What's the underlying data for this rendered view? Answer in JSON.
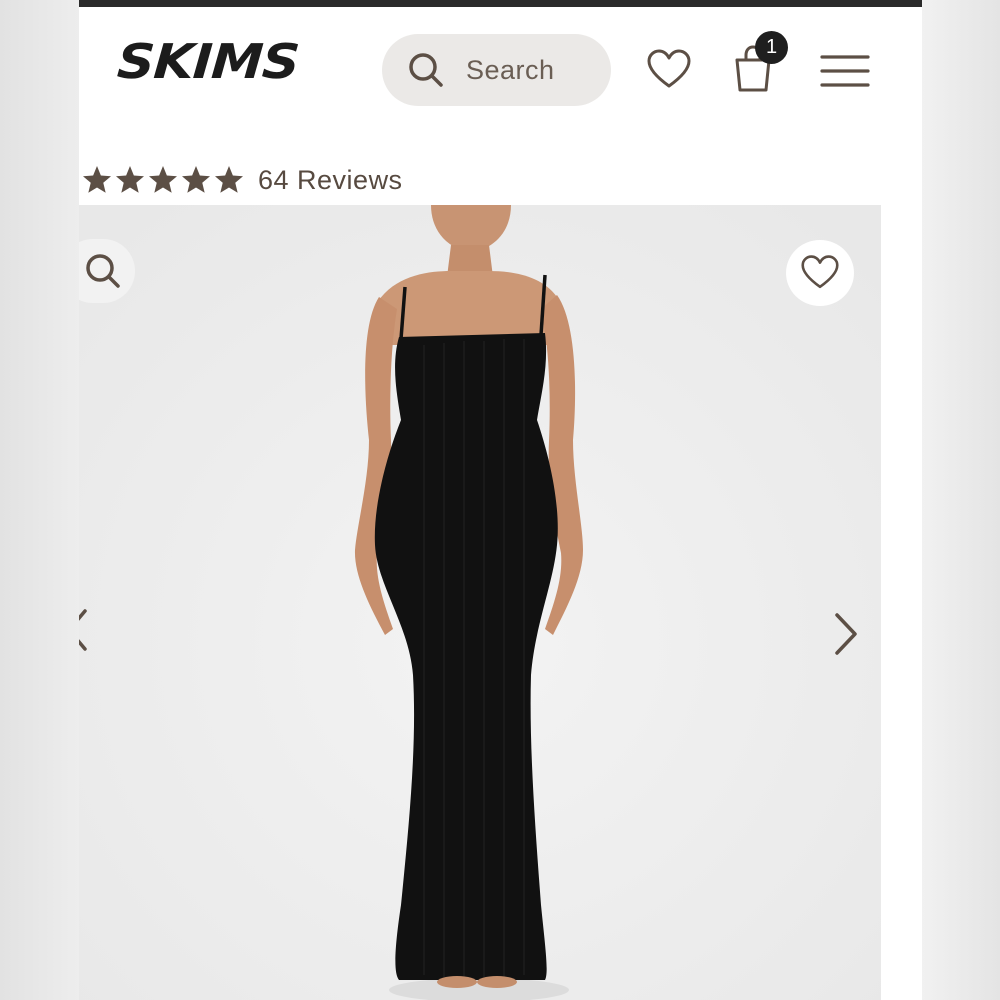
{
  "header": {
    "brand": "SKIMS",
    "search_placeholder": "Search",
    "cart_count": "1",
    "icons": [
      "search-icon",
      "heart-icon",
      "shopping-bag-icon",
      "hamburger-menu-icon"
    ]
  },
  "rating": {
    "stars": 5,
    "reviews_label": "64 Reviews"
  },
  "gallery": {
    "icons": [
      "zoom-icon",
      "heart-icon",
      "chevron-left-icon",
      "chevron-right-icon"
    ]
  },
  "colors": {
    "brand_text": "#1c1c1c",
    "accent_brown": "#5c4f45",
    "search_bg": "#ebe9e7",
    "image_bg": "#eeeeee"
  }
}
